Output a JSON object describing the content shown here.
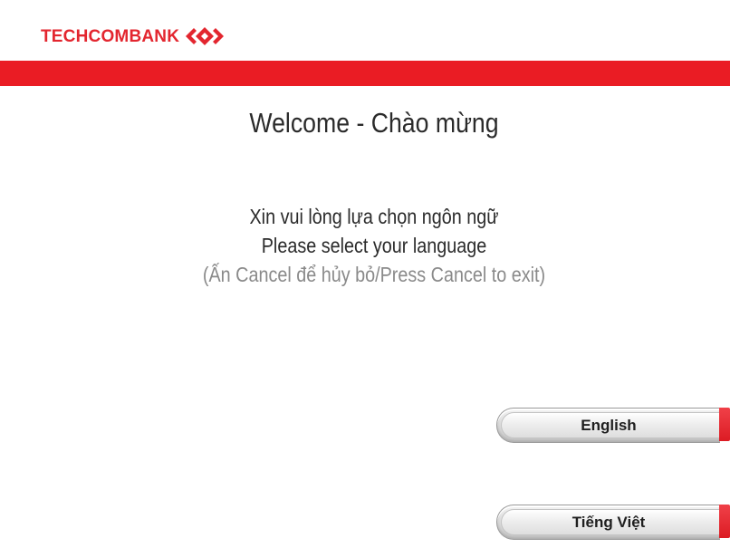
{
  "brand": {
    "name": "TECHCOMBANK",
    "primary_color": "#ea1c24"
  },
  "welcome_title": "Welcome - Chào mừng",
  "prompt": {
    "vietnamese": "Xin vui lòng lựa chọn ngôn ngữ",
    "english": "Please select your language",
    "cancel_hint": "(Ấn Cancel để hủy bỏ/Press Cancel to exit)"
  },
  "language_buttons": [
    {
      "label": "English"
    },
    {
      "label": "Tiếng Việt"
    }
  ]
}
